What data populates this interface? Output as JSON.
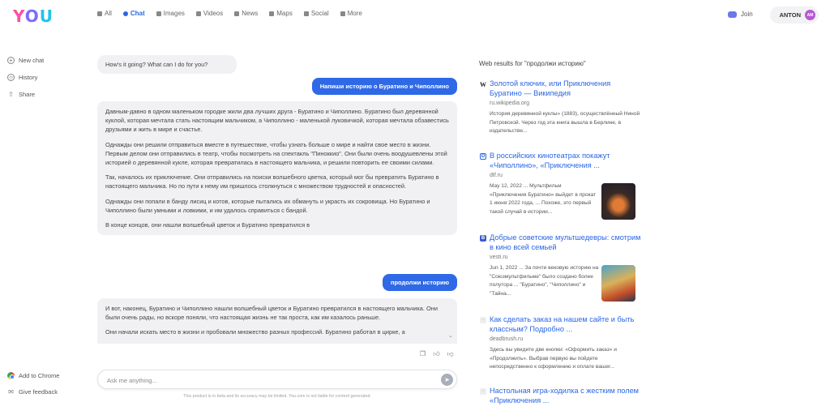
{
  "app": {
    "logo": "YOU",
    "nav": [
      {
        "label": "All",
        "icon": "grid-icon"
      },
      {
        "label": "Chat",
        "icon": "chat-icon",
        "active": true
      },
      {
        "label": "Images",
        "icon": "image-icon"
      },
      {
        "label": "Videos",
        "icon": "video-icon"
      },
      {
        "label": "News",
        "icon": "news-icon"
      },
      {
        "label": "Maps",
        "icon": "map-icon"
      },
      {
        "label": "Social",
        "icon": "social-icon"
      },
      {
        "label": "More",
        "icon": "more-icon"
      }
    ],
    "join_label": "Join",
    "user": {
      "name": "ANTON",
      "initials": "AM"
    },
    "accent_color": "#2b66e5"
  },
  "sidebar": {
    "items": [
      {
        "label": "New chat",
        "icon": "plus-icon"
      },
      {
        "label": "History",
        "icon": "history-icon"
      },
      {
        "label": "Share",
        "icon": "share-icon"
      }
    ],
    "bottom": [
      {
        "label": "Add to Chrome",
        "icon": "chrome-icon"
      },
      {
        "label": "Give feedback",
        "icon": "feedback-icon"
      }
    ]
  },
  "chat": {
    "greeting": "How's it going? What can I do for you?",
    "user_msg_1": "Напиши историю о Буратино и Чиполлино",
    "ai_msg_1": [
      "Давным-давно в одном маленьком городке жили два лучших друга - Буратино и Чиполлино. Буратино был деревянной куклой, которая мечтала стать настоящим мальчиком, а Чиполлино - маленькой луковичкой, которая мечтала обзавестись друзьями и жить в мире и счастье.",
      "Однажды они решили отправиться вместе в путешествие, чтобы узнать больше о мире и найти свое место в жизни. Первым делом они отправились в театр, чтобы посмотреть на спектакль \"Пиноккио\". Они были очень воодушевлены этой историей о деревянной кукле, которая превратилась в настоящего мальчика, и решили повторить ее своими силами.",
      "Так, началось их приключение. Они отправились на поиски волшебного цветка, который мог бы превратить Буратино в настоящего мальчика. Но по пути к нему им пришлось столкнуться с множеством трудностей и опасностей.",
      "Однажды они попали в банду лисиц и котов, которые пытались их обмануть и украсть их сокровища. Но Буратино и Чиполлино были умными и ловкими, и им удалось справиться с бандой.",
      "В конце концов, они нашли волшебный цветок и Буратино превратился в"
    ],
    "user_msg_2": "продолжи историю",
    "ai_msg_2": [
      "И вот, наконец, Буратино и Чиполлино нашли волшебный цветок и Буратино превратился в настоящего мальчика. Они были очень рады, но вскоре поняли, что настоящая жизнь не так проста, как им казалось раньше.",
      "Они начали искать место в жизни и пробовали множество разных профессий. Буратино работал в цирке, а"
    ],
    "input_placeholder": "Ask me anything...",
    "disclaimer": "This product is in beta and its accuracy may be limited. You.com is not liable for content generated."
  },
  "web": {
    "header": "Web results for \"продолжи историю\"",
    "results": [
      {
        "favicon": "W",
        "title": "Золотой ключик, или Приключения Буратино — Википедия",
        "domain": "ru.wikipedia.org",
        "snippet": "История деревянной куклы» (1883), осуществлённый Ниной Петровской. Через год эта книга вышла в Берлине, в издательстве..."
      },
      {
        "favicon": "D",
        "title": "В российских кинотеатрах покажут «Чиполлино», «Приключения ...",
        "domain": "dtf.ru",
        "snippet": "May 12, 2022 ... Мультфильм «Приключения Буратино» выйдет в прокат 1 июня 2022 года, ... Похоже, это первый такой случай в истории..."
      },
      {
        "favicon": "B",
        "title": "Добрые советские мультшедевры: смотрим в кино всей семьей",
        "domain": "vesti.ru",
        "snippet": "Jun 1, 2022 ... За почти вековую историю на \"Союзмультфильме\" было создано более полутора ... \"Буратино\", \"Чиполлино\" и \"Тайна..."
      },
      {
        "favicon": "·",
        "title": "Как сделать заказ на нашем сайте и быть классным? Подробно ...",
        "domain": "deadbrush.ru",
        "snippet": "Здесь вы увидите две кнопки: «Оформить заказ» и «Продолжить». Выбрав первую вы пойдете непосредственно к оформлению и оплате вашег..."
      },
      {
        "favicon": "·",
        "title": "Настольная игра-ходилка с жестким полем «Приключения ..."
      }
    ]
  }
}
